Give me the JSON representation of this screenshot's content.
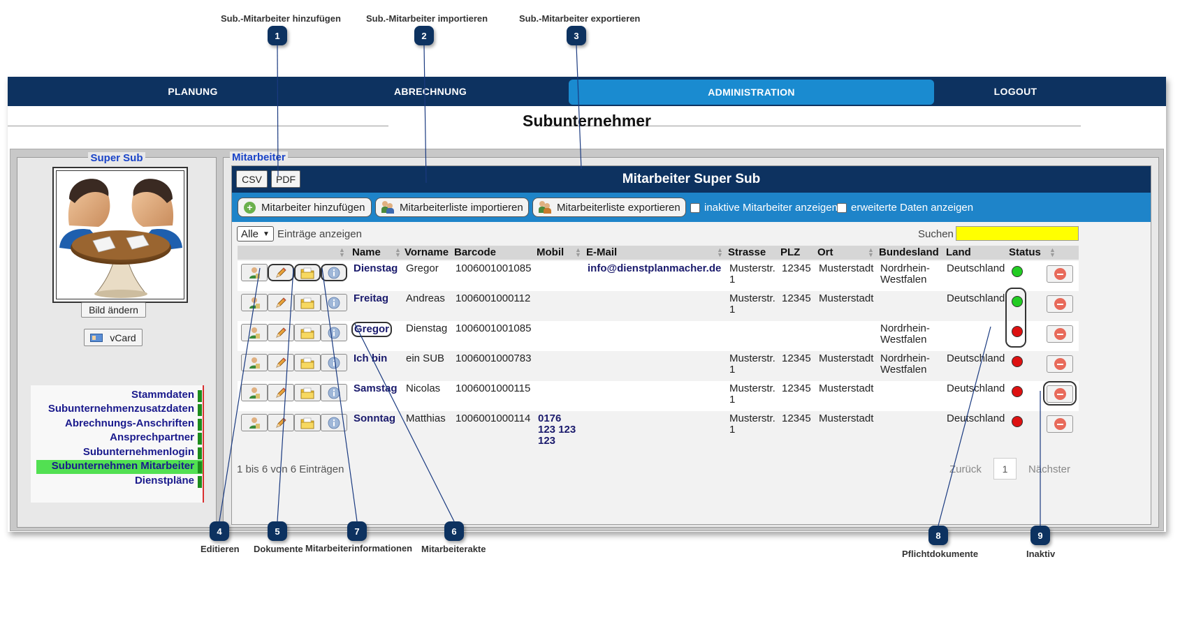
{
  "callouts": [
    {
      "number": "1",
      "label": "Sub.-Mitarbeiter hinzufügen"
    },
    {
      "number": "2",
      "label": "Sub.-Mitarbeiter importieren"
    },
    {
      "number": "3",
      "label": "Sub.-Mitarbeiter exportieren"
    },
    {
      "number": "4",
      "label": "Editieren"
    },
    {
      "number": "5",
      "label": "Dokumente"
    },
    {
      "number": "7",
      "label": "Mitarbeiterinformationen"
    },
    {
      "number": "6",
      "label": "Mitarbeiterakte"
    },
    {
      "number": "8",
      "label": "Pflichtdokumente"
    },
    {
      "number": "9",
      "label": "Inaktiv"
    }
  ],
  "nav": {
    "items": [
      "PLANUNG",
      "ABRECHNUNG",
      "ADMINISTRATION",
      "LOGOUT"
    ],
    "active": "ADMINISTRATION"
  },
  "page_title": "Subunternehmer",
  "left_panel": {
    "legend": "Super Sub",
    "change_image_label": "Bild ändern",
    "vcard_label": "vCard",
    "menu": [
      "Stammdaten",
      "Subunternehmenzusatzdaten",
      "Abrechnungs-Anschriften",
      "Ansprechpartner",
      "Subunternehmenlogin",
      "Subunternehmen Mitarbeiter",
      "Dienstpläne"
    ],
    "menu_active": "Subunternehmen Mitarbeiter"
  },
  "right_panel": {
    "legend": "Mitarbeiter",
    "grid_title": "Mitarbeiter Super Sub",
    "export_buttons": [
      "CSV",
      "PDF"
    ],
    "toolbar": {
      "add_label": "Mitarbeiter hinzufügen",
      "import_label": "Mitarbeiterliste importieren",
      "export_label": "Mitarbeiterliste exportieren",
      "show_inactive_label": "inaktive Mitarbeiter anzeigen",
      "show_extended_label": "erweiterte Daten anzeigen"
    },
    "page_length": {
      "selected": "Alle",
      "suffix": "Einträge anzeigen"
    },
    "search_label": "Suchen",
    "search_value": "",
    "columns": [
      "Name",
      "Vorname",
      "Barcode",
      "Mobil",
      "E-Mail",
      "Strasse",
      "PLZ",
      "Ort",
      "Bundesland",
      "Land",
      "Status"
    ],
    "rows": [
      {
        "name": "Dienstag",
        "vorname": "Gregor",
        "barcode": "1006001001085",
        "mobil": "",
        "email": "info@dienstplanmacher.de",
        "strasse": "Musterstr.\n1",
        "plz": "12345",
        "ort": "Musterstadt",
        "bundesland": "Nordrhein-\nWestfalen",
        "land": "Deutschland",
        "status": "green"
      },
      {
        "name": "Freitag",
        "vorname": "Andreas",
        "barcode": "1006001000112",
        "mobil": "",
        "email": "",
        "strasse": "Musterstr.\n1",
        "plz": "12345",
        "ort": "Musterstadt",
        "bundesland": "",
        "land": "Deutschland",
        "status": "green"
      },
      {
        "name": "Gregor",
        "vorname": "Dienstag",
        "barcode": "1006001001085",
        "mobil": "",
        "email": "",
        "strasse": "",
        "plz": "",
        "ort": "",
        "bundesland": "Nordrhein-\nWestfalen",
        "land": "",
        "status": "red"
      },
      {
        "name": "Ich bin",
        "vorname": "ein SUB",
        "barcode": "1006001000783",
        "mobil": "",
        "email": "",
        "strasse": "Musterstr.\n1",
        "plz": "12345",
        "ort": "Musterstadt",
        "bundesland": "Nordrhein-\nWestfalen",
        "land": "Deutschland",
        "status": "red"
      },
      {
        "name": "Samstag",
        "vorname": "Nicolas",
        "barcode": "1006001000115",
        "mobil": "",
        "email": "",
        "strasse": "Musterstr.\n1",
        "plz": "12345",
        "ort": "Musterstadt",
        "bundesland": "",
        "land": "Deutschland",
        "status": "red"
      },
      {
        "name": "Sonntag",
        "vorname": "Matthias",
        "barcode": "1006001000114",
        "mobil": "0176\n123 123\n123",
        "email": "",
        "strasse": "Musterstr.\n1",
        "plz": "12345",
        "ort": "Musterstadt",
        "bundesland": "",
        "land": "Deutschland",
        "status": "red"
      }
    ],
    "footer_info": "1 bis 6 von 6 Einträgen",
    "pager": {
      "prev": "Zurück",
      "page": "1",
      "next": "Nächster"
    }
  },
  "colors": {
    "nav_bg": "#0d3260",
    "nav_active": "#1a8bd0",
    "toolbar_bg": "#1e84c9",
    "status_green": "#22cc22",
    "status_red": "#dd1111",
    "search_bg": "#ffff00",
    "menu_active_bg": "#52e052"
  }
}
